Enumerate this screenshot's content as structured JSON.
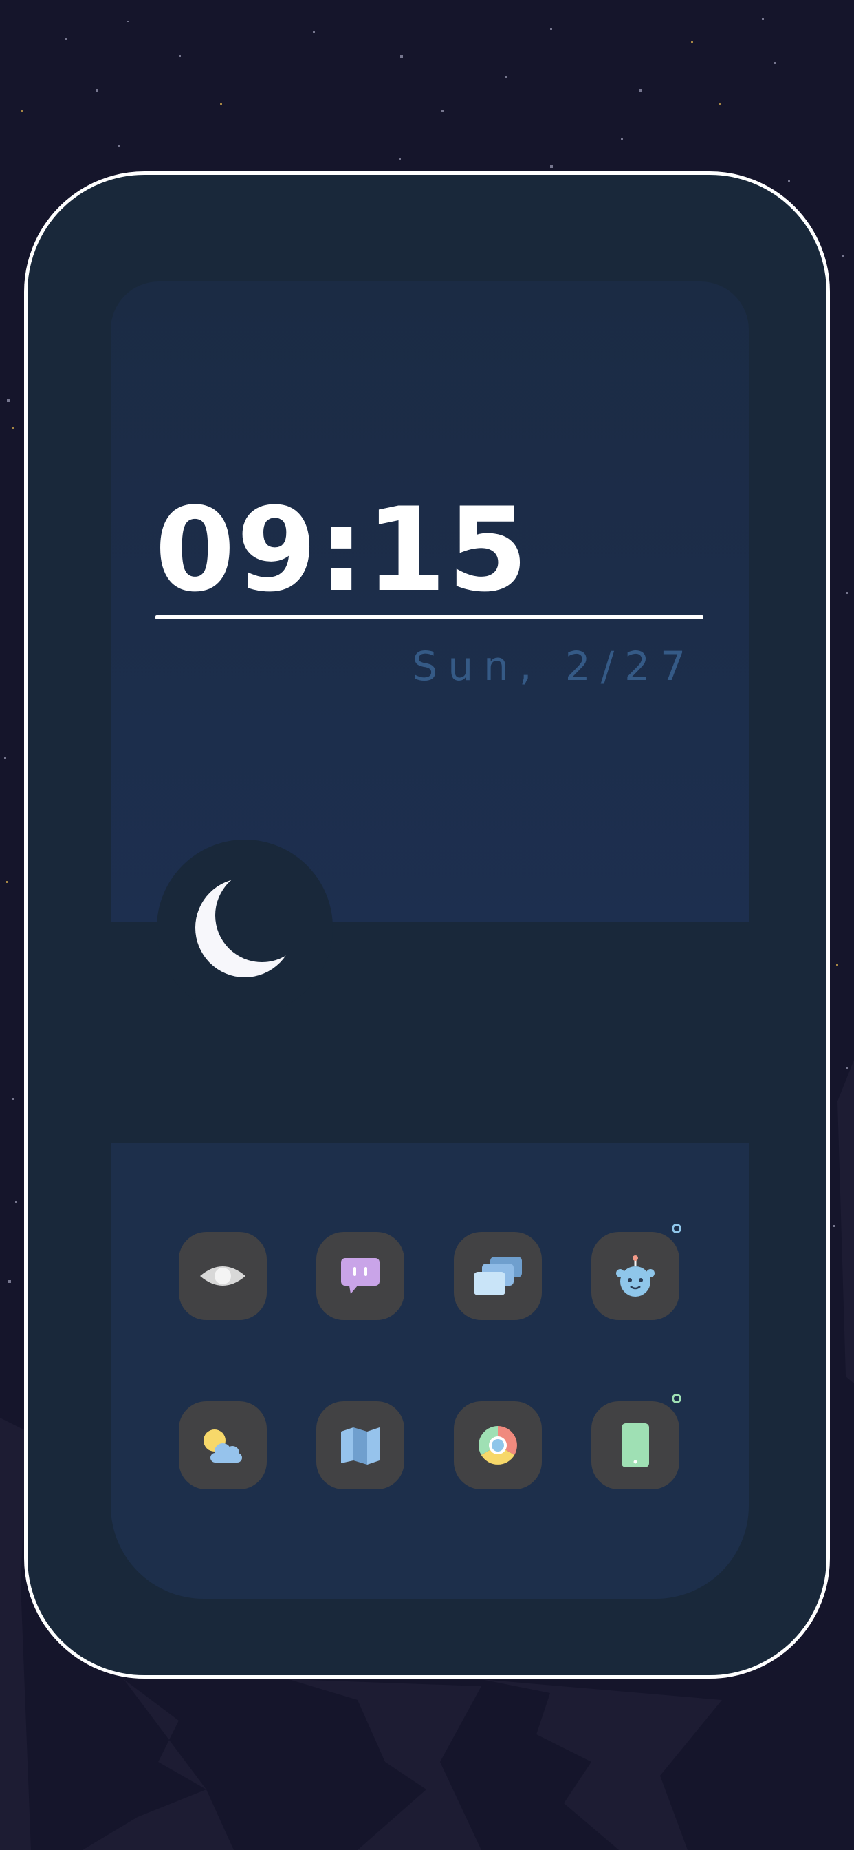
{
  "clock": {
    "time": "09:15",
    "date": "Sun, 2/27"
  },
  "status_indicator": {
    "icon": "moon-icon"
  },
  "apps": [
    {
      "name": "eye-app",
      "icon": "eye-icon"
    },
    {
      "name": "messages-app",
      "icon": "chat-bubble-icon"
    },
    {
      "name": "windows-app",
      "icon": "stacked-windows-icon"
    },
    {
      "name": "robot-app",
      "icon": "robot-face-icon",
      "has_notification_dot": true,
      "dot_color": "#8fc6ea"
    },
    {
      "name": "weather-app",
      "icon": "sun-cloud-icon"
    },
    {
      "name": "maps-app",
      "icon": "map-icon"
    },
    {
      "name": "browser-app",
      "icon": "chrome-icon"
    },
    {
      "name": "phone-app",
      "icon": "smartphone-icon",
      "has_notification_dot": true,
      "dot_color": "#9fe0b4"
    }
  ],
  "colors": {
    "background": "#15152b",
    "frame": "#19283a",
    "panel": "#1d2f4b",
    "date_text": "#355a86",
    "app_tile": "#424244"
  }
}
